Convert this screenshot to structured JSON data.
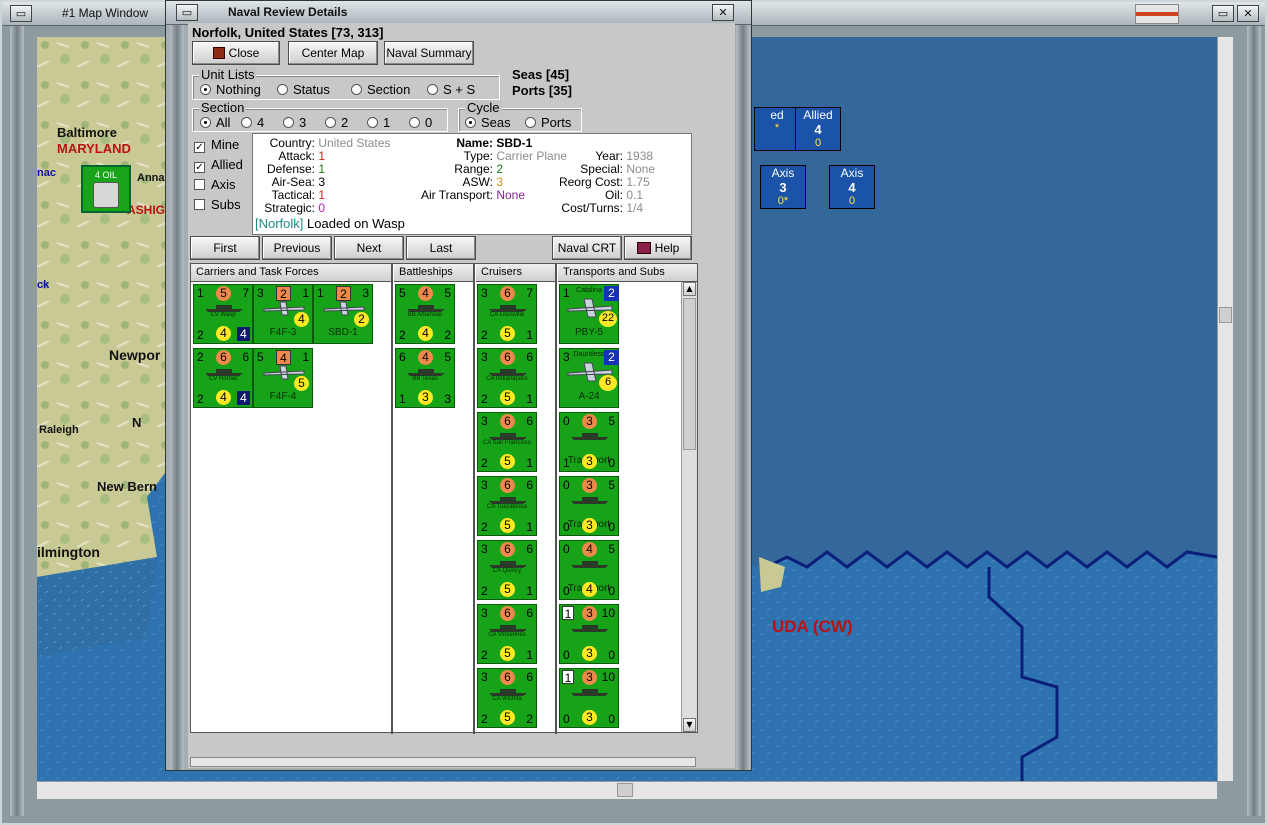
{
  "map_window": {
    "title": "#1 Map Window",
    "labels": {
      "baltimore": "Baltimore",
      "maryland": "MARYLAND",
      "annapolis_partial": "Anna",
      "washington_partial": "ASHIG",
      "oil_counter": "4 OIL",
      "newport": "Newpor",
      "norfolk_partial": "N",
      "raleigh": "Raleigh",
      "new_bern": "New Bern",
      "wilmington": "ilmington",
      "bermuda": "UDA (CW)",
      "mac": "nac",
      "ck": "ck"
    },
    "counters": [
      {
        "side": "ed",
        "value": "",
        "sub": "*"
      },
      {
        "side": "Allied",
        "value": "4",
        "sub": "0"
      },
      {
        "side": "Axis",
        "value": "3",
        "sub": "0*"
      },
      {
        "side": "Axis",
        "value": "4",
        "sub": "0"
      }
    ]
  },
  "dialog": {
    "title": "Naval Review Details",
    "location": "Norfolk, United States [73, 313]",
    "buttons": {
      "close": "Close",
      "center_map": "Center Map",
      "naval_summary": "Naval Summary",
      "first": "First",
      "previous": "Previous",
      "next": "Next",
      "last": "Last",
      "naval_crt": "Naval CRT",
      "help": "Help"
    },
    "counts": {
      "seas": "Seas [45]",
      "ports": "Ports [35]"
    },
    "unit_lists": {
      "legend": "Unit Lists",
      "options": [
        "Nothing",
        "Status",
        "Section",
        "S + S"
      ],
      "selected": "Nothing"
    },
    "section": {
      "legend": "Section",
      "options": [
        "All",
        "4",
        "3",
        "2",
        "1",
        "0"
      ],
      "selected": "All"
    },
    "cycle": {
      "legend": "Cycle",
      "options": [
        "Seas",
        "Ports"
      ],
      "selected": "Seas"
    },
    "filters": [
      {
        "label": "Mine",
        "checked": true
      },
      {
        "label": "Allied",
        "checked": true
      },
      {
        "label": "Axis",
        "checked": false
      },
      {
        "label": "Subs",
        "checked": false
      }
    ],
    "info": {
      "country_label": "Country:",
      "country": "United States",
      "attack_label": "Attack:",
      "attack": "1",
      "defense_label": "Defense:",
      "defense": "1",
      "air_sea_label": "Air-Sea:",
      "air_sea": "3",
      "tactical_label": "Tactical:",
      "tactical": "1",
      "strategic_label": "Strategic:",
      "strategic": "0",
      "location_tag": "[Norfolk]",
      "loaded": "Loaded on Wasp",
      "name_label": "Name:",
      "name": "SBD-1",
      "type_label": "Type:",
      "type": "Carrier Plane",
      "range_label": "Range:",
      "range": "2",
      "asw_label": "ASW:",
      "asw": "3",
      "air_transport_label": "Air Transport:",
      "air_transport": "None",
      "year_label": "Year:",
      "year": "1938",
      "special_label": "Special:",
      "special": "None",
      "reorg_label": "Reorg Cost:",
      "reorg": "1.75",
      "oil_label": "Oil:",
      "oil": "0.1",
      "cost_label": "Cost/Turns:",
      "cost": "1/4"
    },
    "columns": [
      "Carriers and Task Forces",
      "Battleships",
      "Cruisers",
      "Transports and Subs"
    ],
    "carriers": [
      {
        "tl": "1",
        "tm": "5",
        "tr": "7",
        "name": "CV Wasp",
        "bl": "2",
        "bm": "4",
        "br": "4"
      },
      {
        "tl": "3",
        "tm": "2",
        "tr": "1",
        "name": "F4F-3",
        "bl": "",
        "bm": "",
        "br": "4"
      },
      {
        "tl": "1",
        "tm": "2",
        "tr": "3",
        "name": "SBD-1",
        "bl": "",
        "bm": "",
        "br": "2"
      },
      {
        "tl": "2",
        "tm": "6",
        "tr": "6",
        "name": "CV Hornet",
        "bl": "2",
        "bm": "4",
        "br": "4"
      },
      {
        "tl": "5",
        "tm": "4",
        "tr": "1",
        "name": "F4F-4",
        "bl": "",
        "bm": "",
        "br": "5"
      }
    ],
    "battleships": [
      {
        "tl": "5",
        "tm": "4",
        "tr": "5",
        "name": "BB Arkansas",
        "bl": "2",
        "bm": "4",
        "br": "2"
      },
      {
        "tl": "6",
        "tm": "4",
        "tr": "5",
        "name": "BB Texas",
        "bl": "1",
        "bm": "3",
        "br": "3"
      }
    ],
    "cruisers": [
      {
        "tl": "3",
        "tm": "6",
        "tr": "7",
        "name": "CA Louisville",
        "bl": "2",
        "bm": "5",
        "br": "1"
      },
      {
        "tl": "3",
        "tm": "6",
        "tr": "6",
        "name": "CA Indianapolis",
        "bl": "2",
        "bm": "5",
        "br": "1"
      },
      {
        "tl": "3",
        "tm": "6",
        "tr": "6",
        "name": "CA San Francisco",
        "bl": "2",
        "bm": "5",
        "br": "1"
      },
      {
        "tl": "3",
        "tm": "6",
        "tr": "6",
        "name": "CA Tuscaloosa",
        "bl": "2",
        "bm": "5",
        "br": "1"
      },
      {
        "tl": "3",
        "tm": "6",
        "tr": "6",
        "name": "CA Quincy",
        "bl": "2",
        "bm": "5",
        "br": "1"
      },
      {
        "tl": "3",
        "tm": "6",
        "tr": "6",
        "name": "CA Vincennes",
        "bl": "2",
        "bm": "5",
        "br": "1"
      },
      {
        "tl": "3",
        "tm": "6",
        "tr": "6",
        "name": "CA Wichita",
        "bl": "2",
        "bm": "5",
        "br": "2"
      }
    ],
    "transports": [
      {
        "tl": "1",
        "top": "Catalina",
        "tm": "2",
        "name": "PBY-5",
        "br": "22"
      },
      {
        "tl": "3",
        "top": "Dauntless",
        "tm": "2",
        "name": "A-24",
        "br": "6"
      },
      {
        "tl": "0",
        "tm": "3",
        "tr": "5",
        "name": "Transport",
        "bl": "1",
        "bm": "3",
        "br": "0"
      },
      {
        "tl": "0",
        "tm": "3",
        "tr": "5",
        "name": "Transport",
        "bl": "0",
        "bm": "3",
        "br": "0"
      },
      {
        "tl": "0",
        "tm": "4",
        "tr": "5",
        "name": "Transport",
        "bl": "0",
        "bm": "4",
        "br": "0"
      },
      {
        "tl": "1",
        "tm": "3",
        "tr": "10",
        "name": "",
        "bl": "0",
        "bm": "3",
        "br": "0"
      },
      {
        "tl": "1",
        "tm": "3",
        "tr": "10",
        "name": "",
        "bl": "0",
        "bm": "3",
        "br": "0"
      }
    ]
  }
}
